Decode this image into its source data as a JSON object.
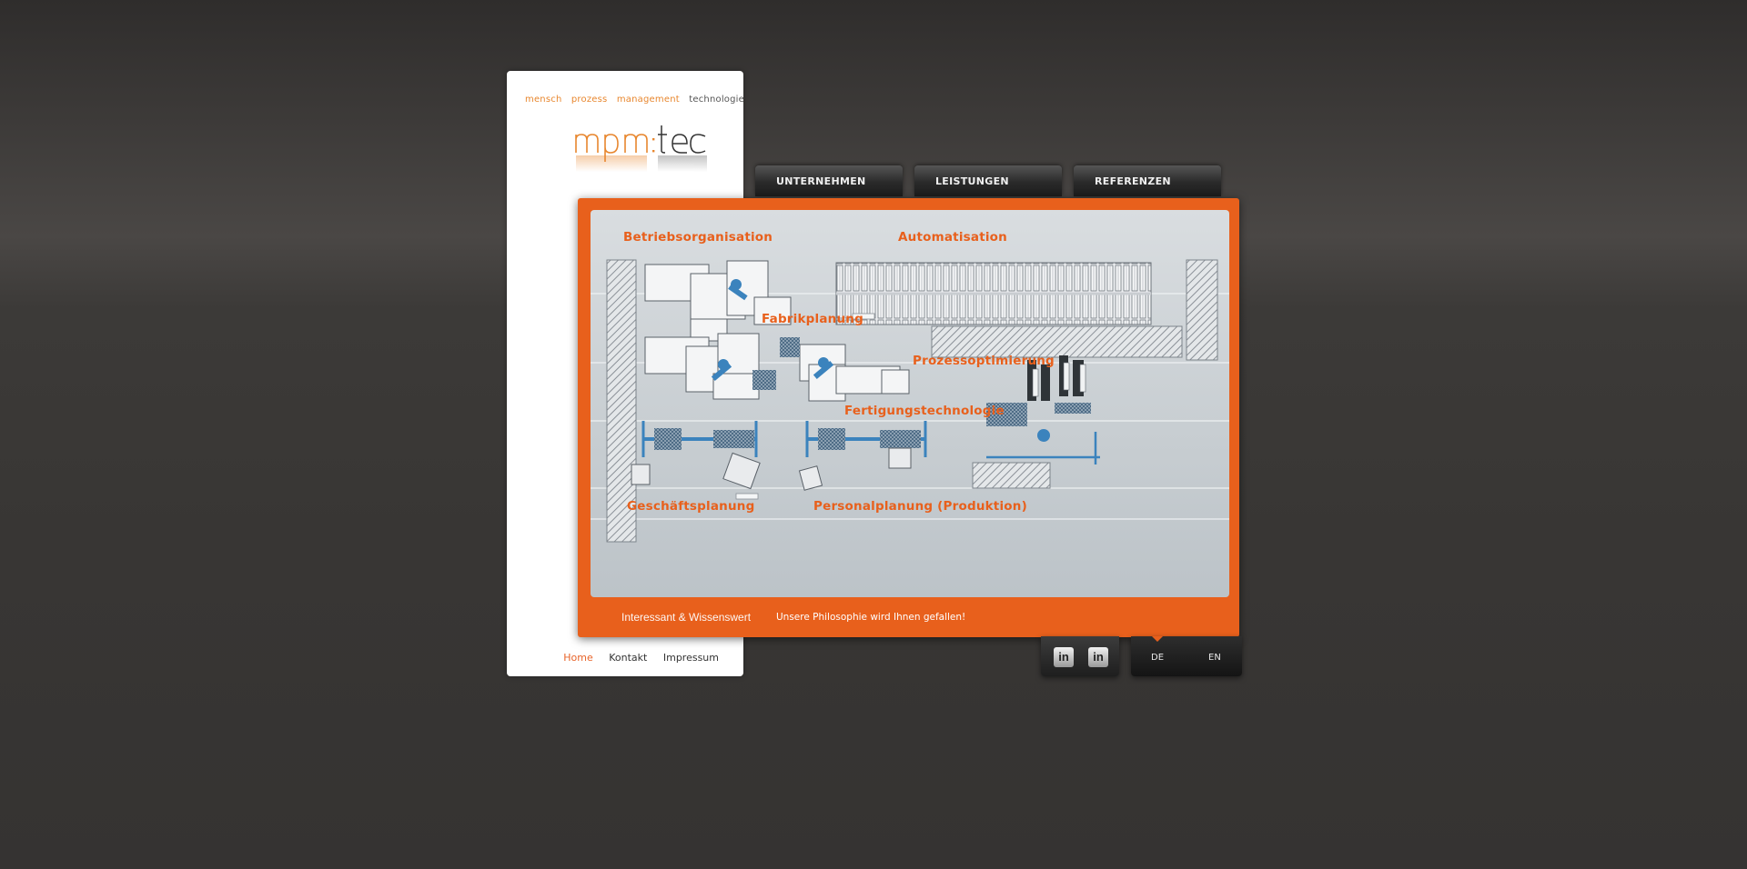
{
  "brand": {
    "tagline": [
      "mensch",
      "prozess",
      "management",
      "technologie"
    ],
    "logo_text": "mpm:tec"
  },
  "nav": {
    "tabs": [
      {
        "label": "UNTERNEHMEN"
      },
      {
        "label": "LEISTUNGEN"
      },
      {
        "label": "REFERENZEN"
      }
    ]
  },
  "diagram": {
    "labels": {
      "betriebsorganisation": "Betriebsorganisation",
      "automatisation": "Automatisation",
      "fabrikplanung": "Fabrikplanung",
      "prozessoptimierung": "Prozessoptimierung",
      "fertigungstechnologie": "Fertigungstechnologie",
      "geschaeftsplanung": "Geschäftsplanung",
      "personalplanung": "Personalplanung (Produktion)"
    }
  },
  "banner": {
    "headline": "Interessant & Wissenswert",
    "text": "Unsere Philosophie wird Ihnen gefallen!"
  },
  "footer": {
    "links": [
      "Home",
      "Kontakt",
      "Impressum"
    ],
    "active": "Home"
  },
  "social": {
    "icons": [
      "linkedin-icon",
      "linkedin-icon"
    ],
    "icon_text": "in"
  },
  "language": {
    "options": [
      "DE",
      "EN"
    ],
    "selected": "DE"
  },
  "colors": {
    "accent": "#e8601c",
    "tagline_orange": "#e8872f",
    "background": "#3a3836"
  }
}
